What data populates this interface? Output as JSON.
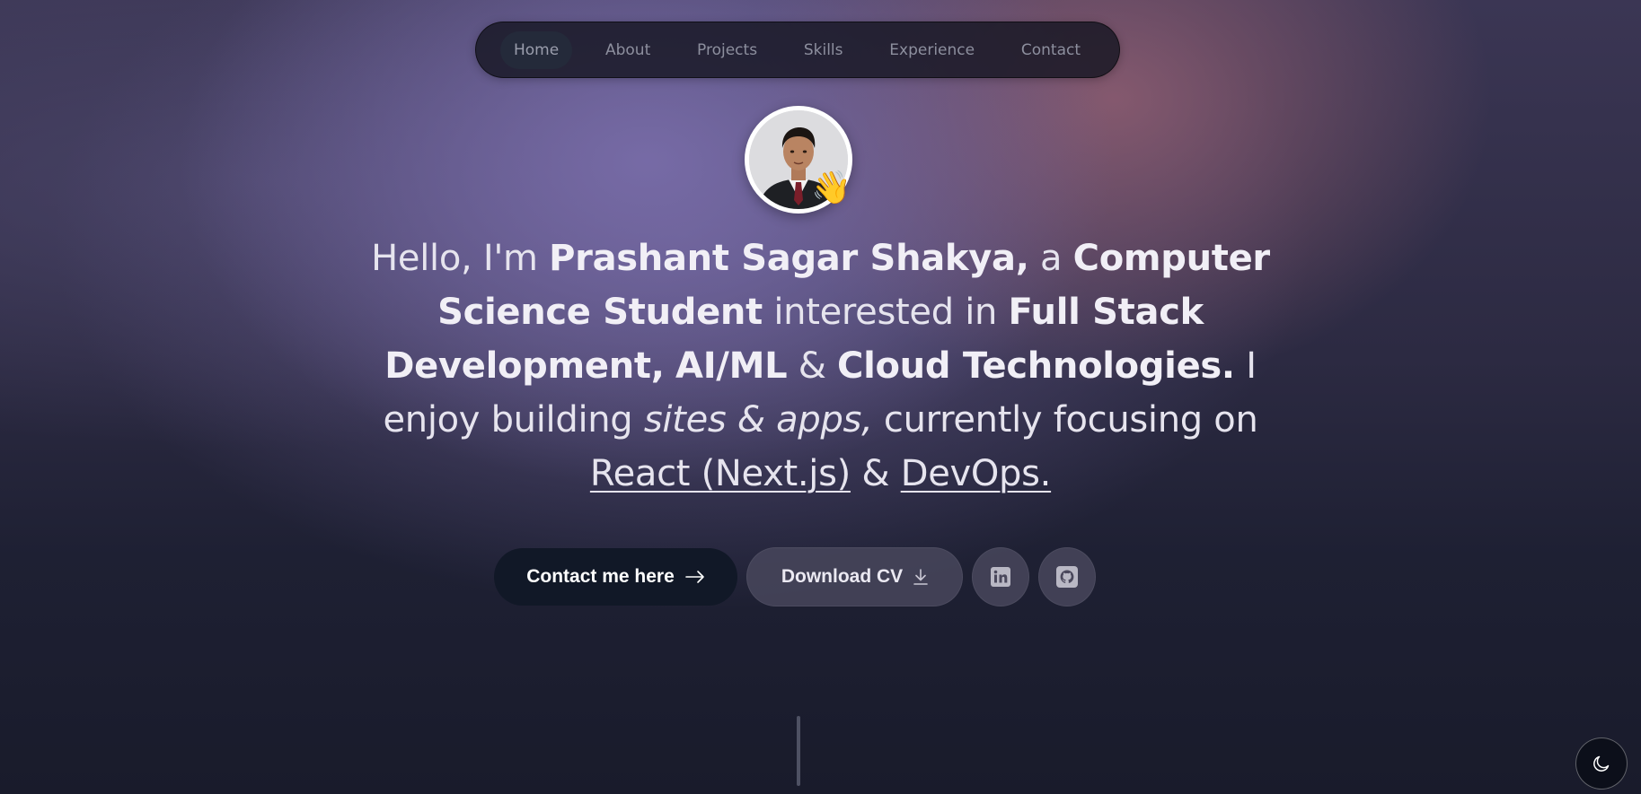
{
  "nav": {
    "items": [
      {
        "label": "Home",
        "active": true
      },
      {
        "label": "About",
        "active": false
      },
      {
        "label": "Projects",
        "active": false
      },
      {
        "label": "Skills",
        "active": false
      },
      {
        "label": "Experience",
        "active": false
      },
      {
        "label": "Contact",
        "active": false
      }
    ]
  },
  "hero": {
    "wave_emoji": "👋",
    "intro": "Hello, I'm ",
    "name": "Prashant Sagar Shakya,",
    "a": " a ",
    "role": "Computer Science Student",
    "interested": " interested in ",
    "interest1": "Full Stack Development,",
    "interest2": "AI/ML",
    "amp1": " & ",
    "interest3": "Cloud Technologies.",
    "enjoy": " I enjoy building ",
    "what": "sites & apps,",
    "focusing": " currently focusing on ",
    "focus1": "React (Next.js)",
    "amp2": " & ",
    "focus2": "DevOps."
  },
  "actions": {
    "contact_label": "Contact me here",
    "contact_icon": "arrow-right-icon",
    "download_label": "Download CV",
    "download_icon": "download-icon",
    "linkedin_icon": "linkedin-icon",
    "github_icon": "github-icon"
  },
  "theme_toggle": {
    "icon": "moon-icon"
  },
  "colors": {
    "primary_button": "#111827",
    "text": "#e6e4ee"
  }
}
